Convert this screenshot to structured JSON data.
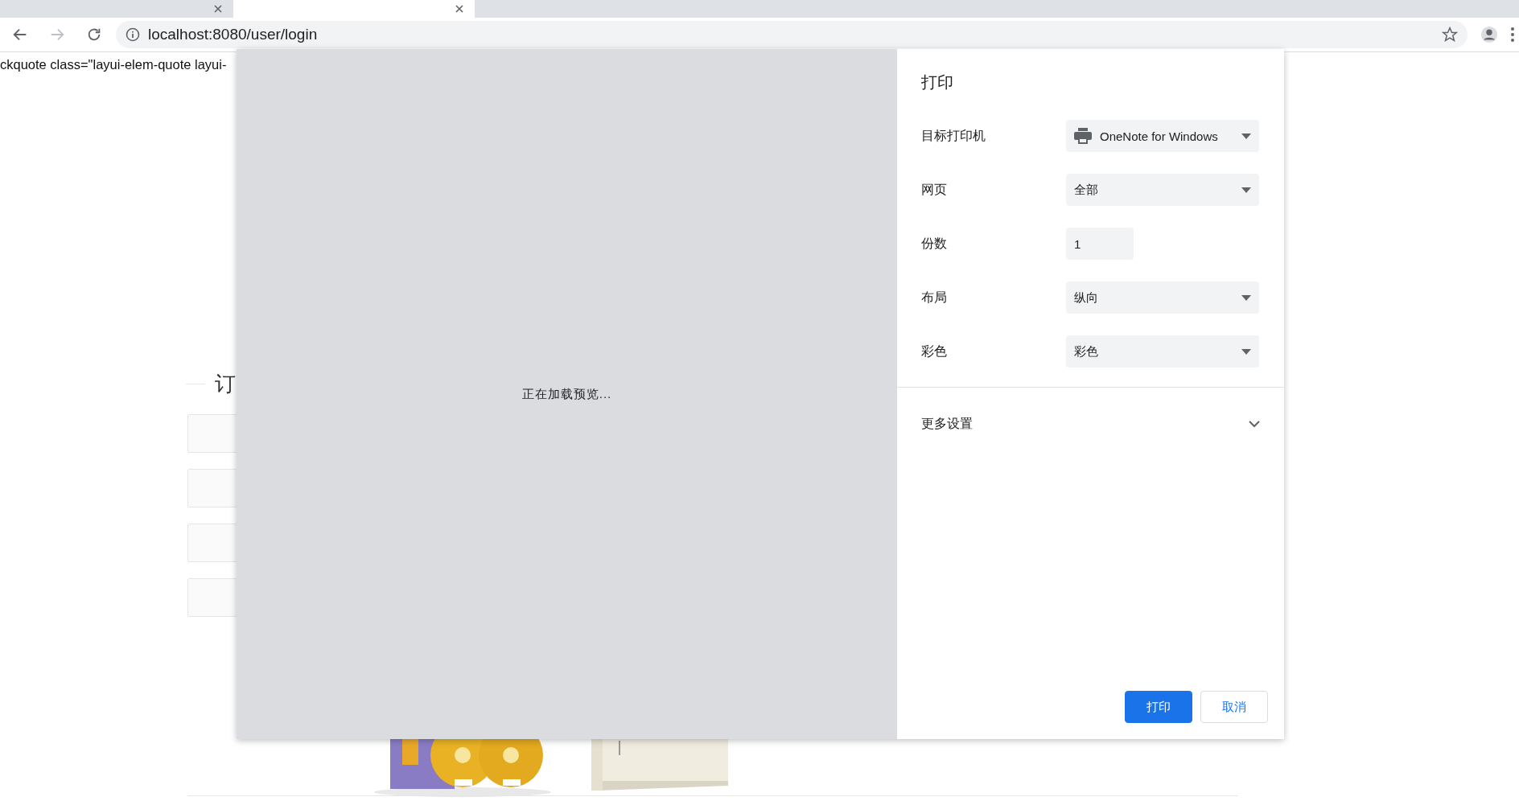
{
  "browser": {
    "tabs": [
      {
        "selected": false
      },
      {
        "selected": true
      }
    ],
    "address": "localhost:8080/user/login"
  },
  "page": {
    "quote_text": "ckquote class=\"layui-elem-quote layui-",
    "heading": "订",
    "fields": [
      {
        "kind": "input"
      },
      {
        "kind": "input"
      },
      {
        "kind": "input"
      },
      {
        "kind": "input"
      }
    ]
  },
  "print_dialog": {
    "preview_message": "正在加载预览...",
    "title": "打印",
    "settings": [
      {
        "label": "目标打印机",
        "kind": "select",
        "value": "OneNote for Windows",
        "icon": true
      },
      {
        "label": "网页",
        "kind": "select",
        "value": "全部",
        "icon": false
      },
      {
        "label": "份数",
        "kind": "input",
        "value": "1",
        "icon": false
      },
      {
        "label": "布局",
        "kind": "select",
        "value": "纵向",
        "icon": false
      },
      {
        "label": "彩色",
        "kind": "select",
        "value": "彩色",
        "icon": false
      }
    ],
    "more_settings": {
      "label": "更多设置",
      "expanded": false
    },
    "buttons": [
      {
        "label": "打印",
        "kind": "primary"
      },
      {
        "label": "取消",
        "kind": "secondary"
      }
    ]
  }
}
